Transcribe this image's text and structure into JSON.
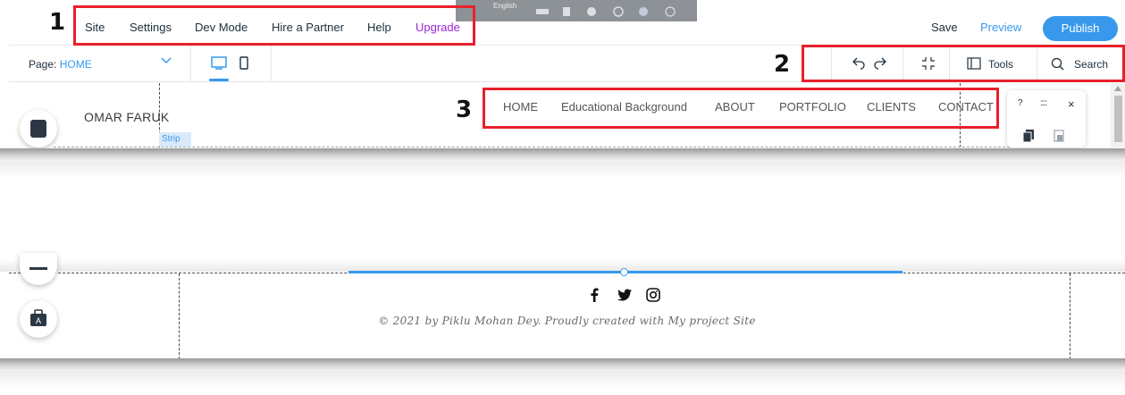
{
  "editor": {
    "menu": {
      "site": "Site",
      "settings": "Settings",
      "dev_mode": "Dev Mode",
      "hire_partner": "Hire a Partner",
      "help": "Help",
      "upgrade": "Upgrade"
    },
    "overlay_language": "English",
    "actions": {
      "save": "Save",
      "preview": "Preview",
      "publish": "Publish"
    },
    "page_selector": {
      "label": "Page:",
      "value": "HOME"
    },
    "tools": {
      "tools_label": "Tools",
      "search_label": "Search"
    }
  },
  "site": {
    "name": "OMAR FARUK",
    "nav": [
      "HOME",
      "Educational Background",
      "ABOUT",
      "PORTFOLIO",
      "CLIENTS",
      "CONTACT"
    ],
    "strip_tag": "Strip",
    "footer_copy": "© 2021 by Piklu Mohan Dey. Proudly created with My project Site"
  },
  "mini_panel": {
    "help": "?",
    "drag": "::::",
    "close": "×"
  },
  "callouts": {
    "one": "1",
    "two": "2",
    "three": "3"
  },
  "colors": {
    "accent": "#3899ec",
    "upgrade": "#9a27d5",
    "callout_red": "#e8202a"
  }
}
